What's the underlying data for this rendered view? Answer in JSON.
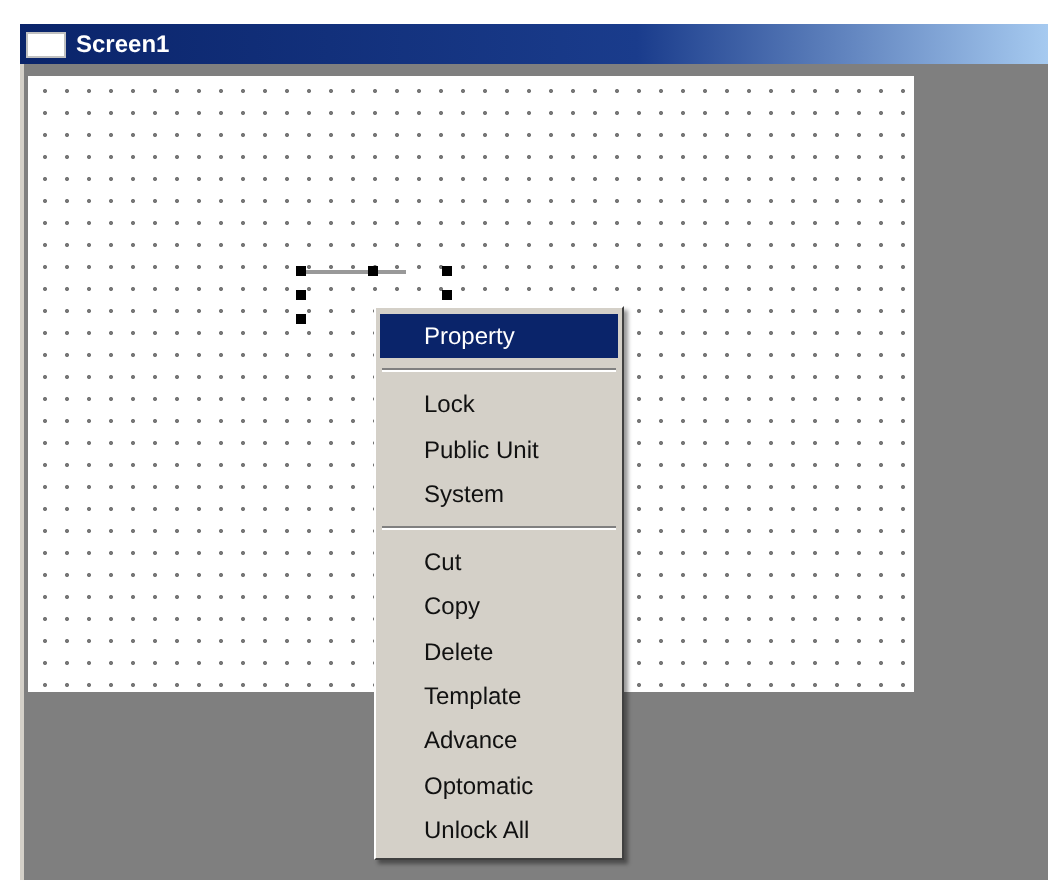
{
  "window": {
    "title": "Screen1"
  },
  "context_menu": {
    "items": [
      {
        "kind": "item",
        "label": "Property",
        "selected": true
      },
      {
        "kind": "separator"
      },
      {
        "kind": "item",
        "label": "Lock",
        "selected": false
      },
      {
        "kind": "item",
        "label": "Public Unit",
        "selected": false
      },
      {
        "kind": "item",
        "label": "System",
        "selected": false
      },
      {
        "kind": "separator"
      },
      {
        "kind": "item",
        "label": "Cut",
        "selected": false
      },
      {
        "kind": "item",
        "label": "Copy",
        "selected": false
      },
      {
        "kind": "item",
        "label": "Delete",
        "selected": false
      },
      {
        "kind": "item",
        "label": "Template",
        "selected": false
      },
      {
        "kind": "item",
        "label": "Advance",
        "selected": false
      },
      {
        "kind": "item",
        "label": "Optomatic",
        "selected": false
      },
      {
        "kind": "item",
        "label": "Unlock All",
        "selected": false
      }
    ]
  }
}
